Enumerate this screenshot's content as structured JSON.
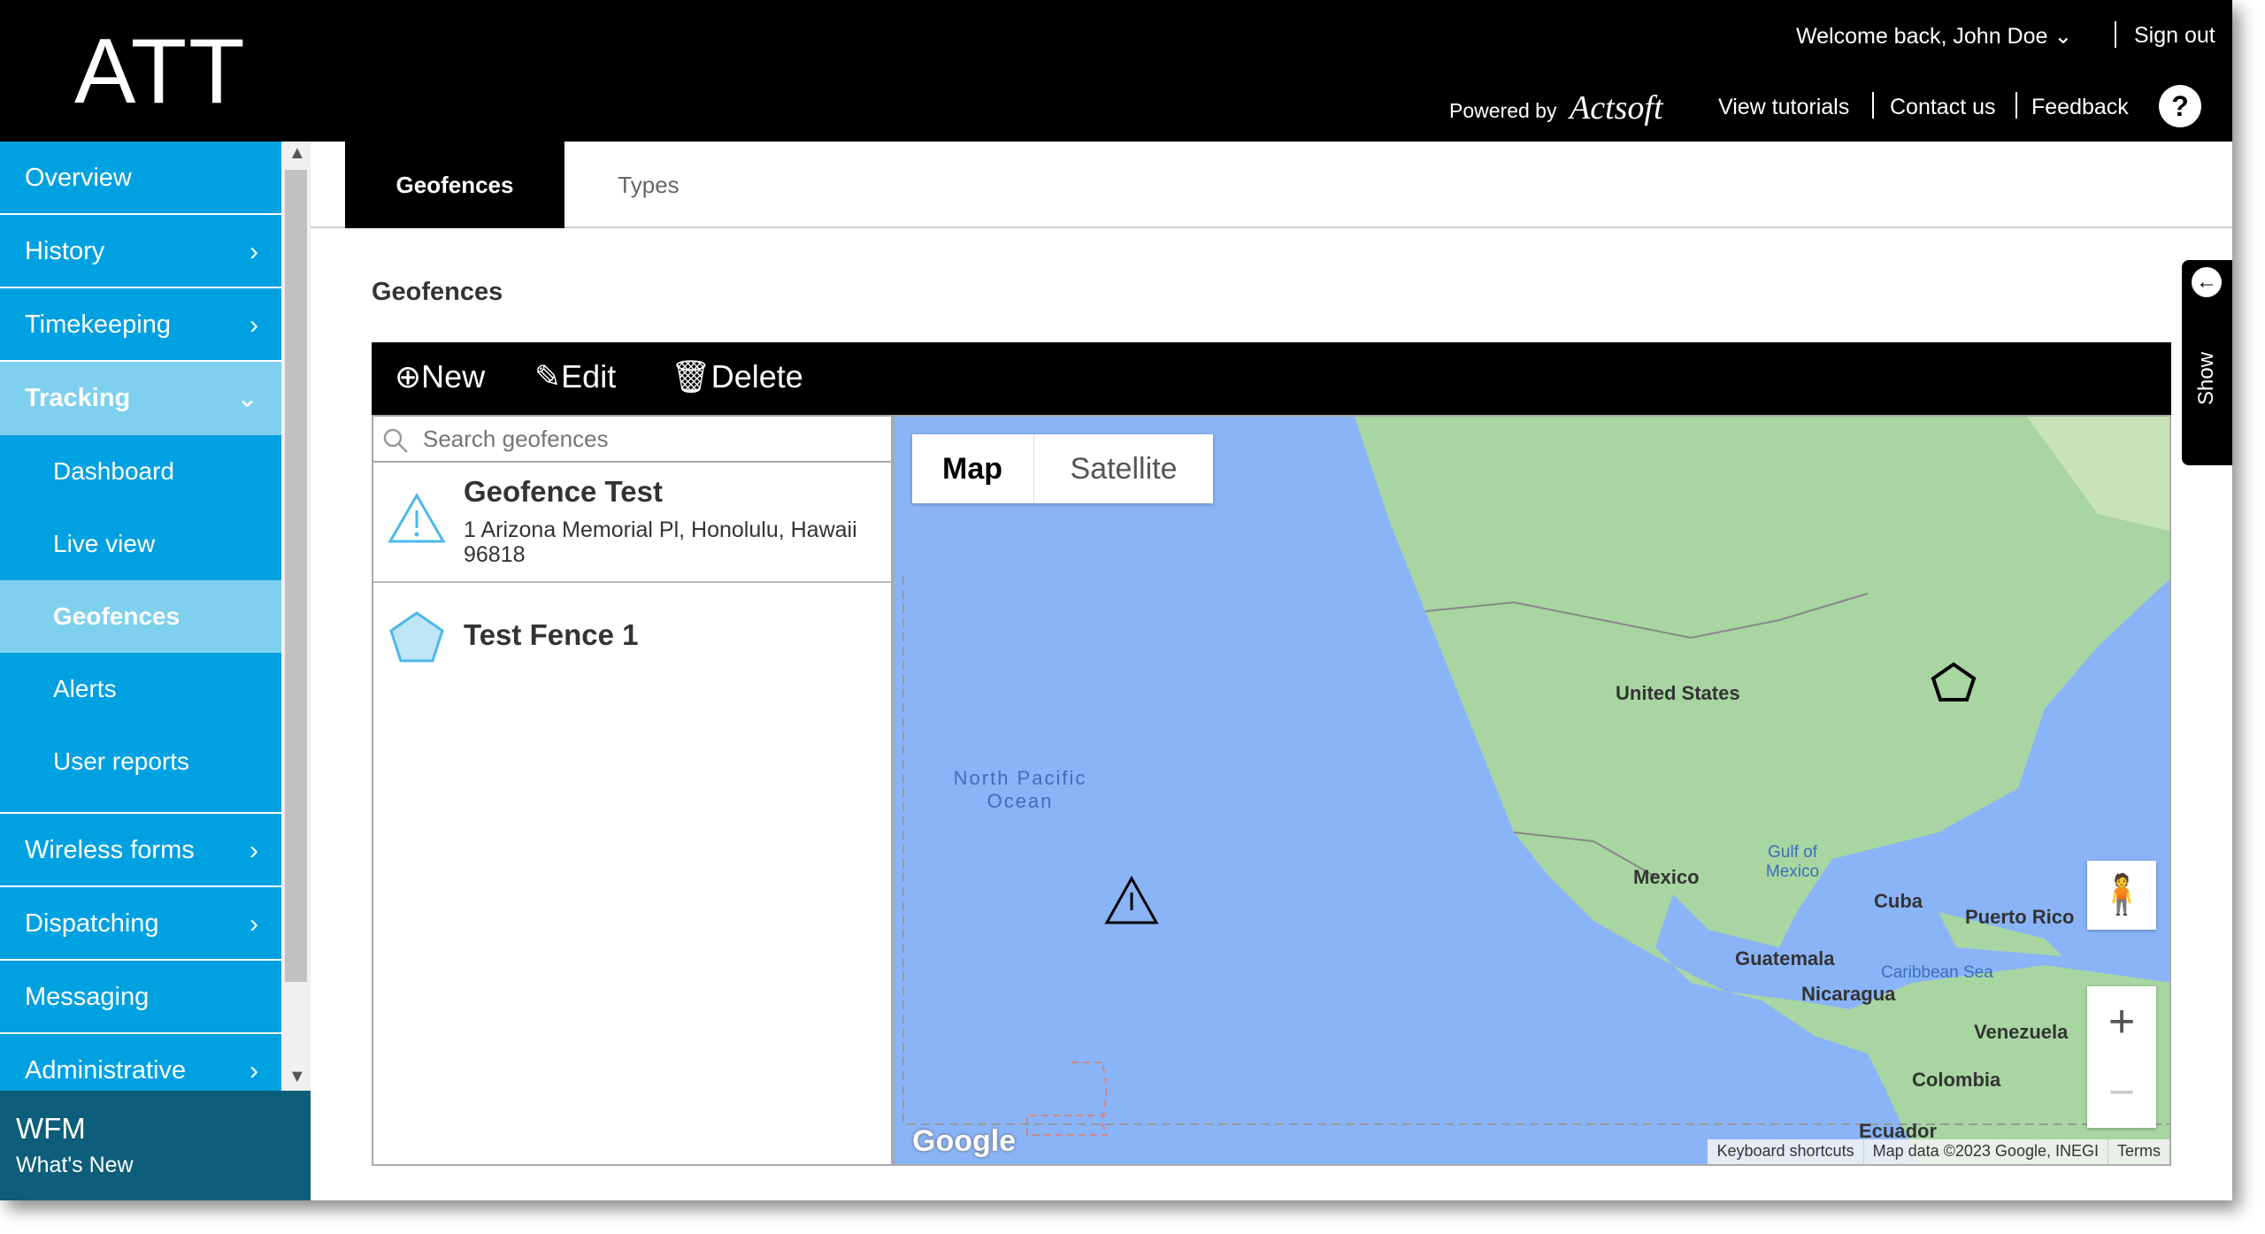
{
  "header": {
    "logo": "ATT",
    "welcome": "Welcome back, John Doe",
    "sign_out": "Sign out",
    "powered_by": "Powered by",
    "brand": "Actsoft",
    "view_tutorials": "View tutorials",
    "contact_us": "Contact us",
    "feedback": "Feedback",
    "help": "?"
  },
  "sidebar": {
    "items": [
      {
        "label": "Overview"
      },
      {
        "label": "History"
      },
      {
        "label": "Timekeeping"
      },
      {
        "label": "Tracking"
      },
      {
        "label": "Dashboard"
      },
      {
        "label": "Live view"
      },
      {
        "label": "Geofences"
      },
      {
        "label": "Alerts"
      },
      {
        "label": "User reports"
      },
      {
        "label": "Wireless forms"
      },
      {
        "label": "Dispatching"
      },
      {
        "label": "Messaging"
      },
      {
        "label": "Administrative"
      }
    ],
    "footer_title": "WFM",
    "footer_link": "What's New"
  },
  "tabs": [
    {
      "label": "Geofences",
      "active": true
    },
    {
      "label": "Types",
      "active": false
    }
  ],
  "page_title": "Geofences",
  "toolbar": {
    "new": "New",
    "edit": "Edit",
    "delete": "Delete"
  },
  "search": {
    "placeholder": "Search geofences"
  },
  "geofences": [
    {
      "name": "Geofence Test",
      "address": "1 Arizona Memorial Pl, Honolulu, Hawaii 96818",
      "icon": "warning-icon"
    },
    {
      "name": "Test Fence 1",
      "address": "",
      "icon": "pentagon-icon"
    }
  ],
  "map": {
    "type_map": "Map",
    "type_satellite": "Satellite",
    "google": "Google",
    "keyboard": "Keyboard shortcuts",
    "map_data": "Map data ©2023 Google, INEGI",
    "terms": "Terms",
    "labels": {
      "ocean": "North Pacific Ocean",
      "us": "United States",
      "mexico": "Mexico",
      "gulf": "Gulf of Mexico",
      "cuba": "Cuba",
      "pr": "Puerto Rico",
      "guatemala": "Guatemala",
      "nicaragua": "Nicaragua",
      "caribbean": "Caribbean Sea",
      "venezuela": "Venezuela",
      "colombia": "Colombia",
      "ecuador": "Ecuador"
    }
  },
  "show_panel": "Show"
}
